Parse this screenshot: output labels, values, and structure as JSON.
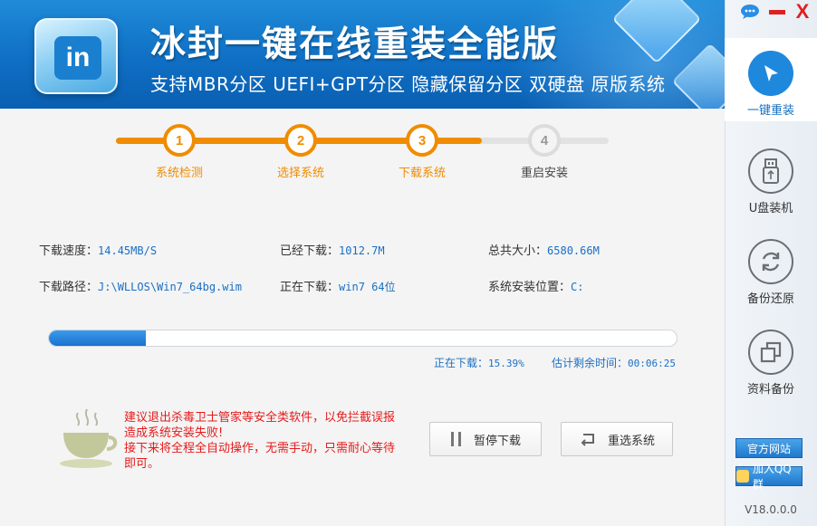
{
  "header": {
    "logo_text": "in",
    "title": "冰封一键在线重装全能版",
    "subtitle": "支持MBR分区  UEFI+GPT分区  隐藏保留分区  双硬盘  原版系统"
  },
  "window_controls": {
    "close_glyph": "X"
  },
  "steps": [
    {
      "num": "1",
      "label": "系统检测",
      "state": "done"
    },
    {
      "num": "2",
      "label": "选择系统",
      "state": "done"
    },
    {
      "num": "3",
      "label": "下载系统",
      "state": "current"
    },
    {
      "num": "4",
      "label": "重启安装",
      "state": "pending"
    }
  ],
  "info": {
    "speed_label": "下载速度：",
    "speed_value": "14.45MB/S",
    "downloaded_label": "已经下载：",
    "downloaded_value": "1012.7M",
    "total_label": "总共大小：",
    "total_value": "6580.66M",
    "path_label": "下载路径：",
    "path_value": "J:\\WLLOS\\Win7_64bg.wim",
    "current_label": "正在下载：",
    "current_value": "win7 64位",
    "install_label": "系统安装位置：",
    "install_value": "C:"
  },
  "progress": {
    "percent": 15.39,
    "percent_label": "正在下载：",
    "percent_text": "15.39%",
    "remaining_label": "估计剩余时间：",
    "remaining_value": "00:06:25"
  },
  "warning": {
    "line1": "建议退出杀毒卫士管家等安全类软件，以免拦截误报造成系统安装失败!",
    "line2": "接下来将全程全自动操作，无需手动，只需耐心等待即可。"
  },
  "buttons": {
    "pause": "暂停下载",
    "reselect": "重选系统"
  },
  "sidebar": {
    "items": [
      {
        "label": "一键重装",
        "icon": "cursor-arrow-icon",
        "active": true
      },
      {
        "label": "U盘装机",
        "icon": "usb-drive-icon",
        "active": false
      },
      {
        "label": "备份还原",
        "icon": "refresh-arrows-icon",
        "active": false
      },
      {
        "label": "资料备份",
        "icon": "copy-icon",
        "active": false
      }
    ],
    "website": "官方网站",
    "qq_group": "加入QQ群",
    "version": "V18.0.0.0"
  },
  "colors": {
    "accent_blue": "#1e88dd",
    "step_orange": "#f08c00",
    "warning_red": "#e51b1b"
  }
}
